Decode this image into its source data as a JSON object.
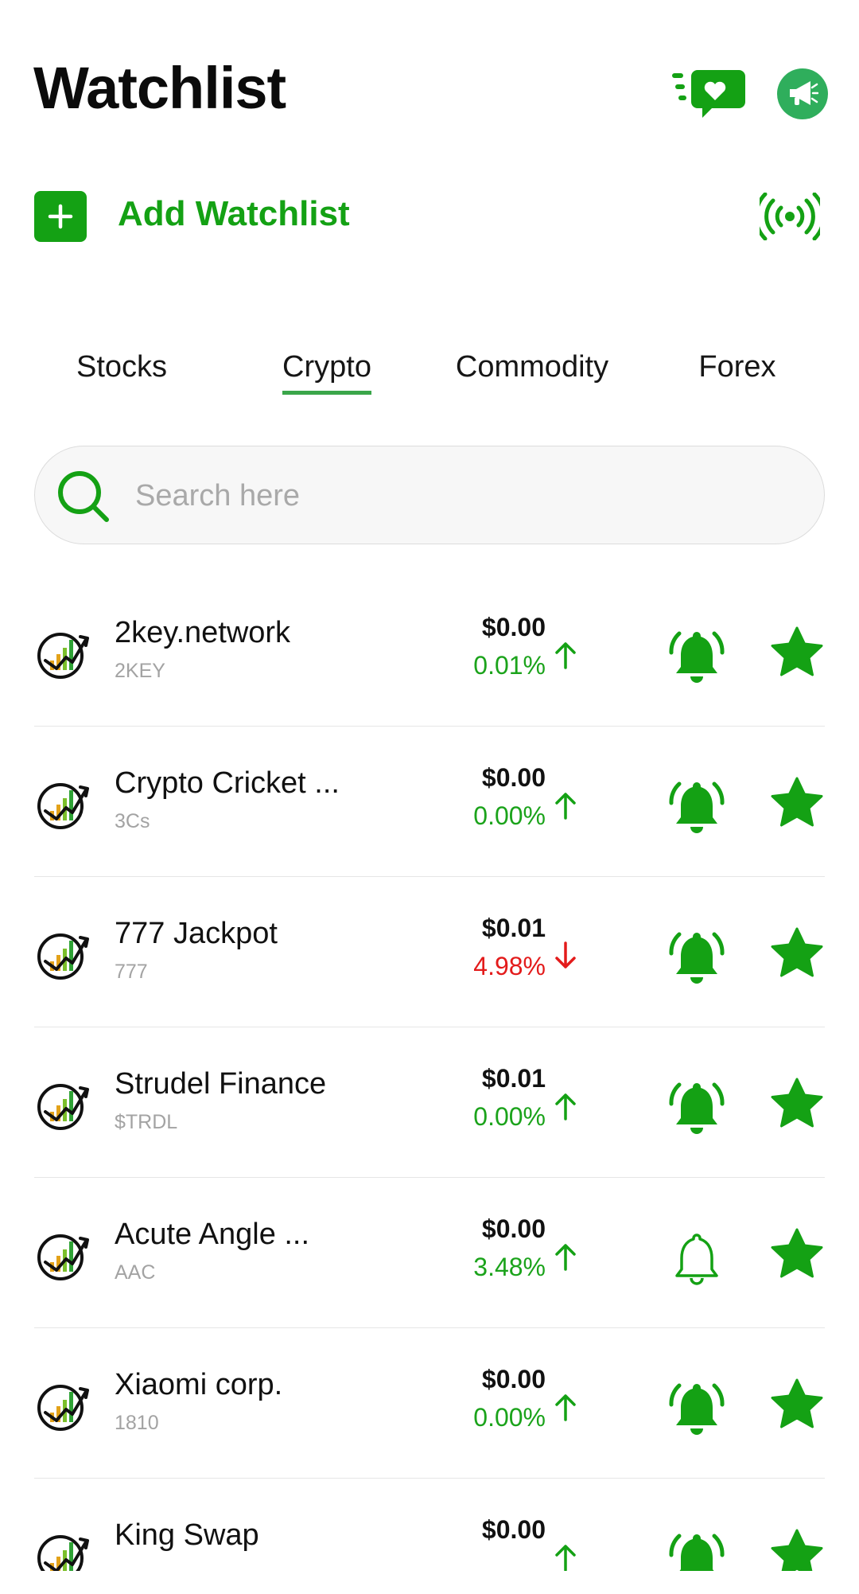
{
  "header": {
    "title": "Watchlist",
    "feed_icon": "feed-heart-icon",
    "profile_icon": "megaphone-icon"
  },
  "add_watchlist": {
    "label": "Add Watchlist",
    "icon": "plus-icon",
    "live_icon": "broadcast-signal-icon"
  },
  "tabs": [
    {
      "label": "Stocks",
      "active": false
    },
    {
      "label": "Crypto",
      "active": true
    },
    {
      "label": "Commodity",
      "active": false
    },
    {
      "label": "Forex",
      "active": false
    }
  ],
  "search": {
    "placeholder": "Search here",
    "value": ""
  },
  "items": [
    {
      "name": "2key.network",
      "symbol": "2KEY",
      "price": "$0.00",
      "change": "0.01%",
      "direction": "up",
      "alert": "on",
      "favorite": true
    },
    {
      "name": "Crypto Cricket ...",
      "symbol": "3Cs",
      "price": "$0.00",
      "change": "0.00%",
      "direction": "up",
      "alert": "on",
      "favorite": true
    },
    {
      "name": "777 Jackpot",
      "symbol": "777",
      "price": "$0.01",
      "change": "4.98%",
      "direction": "down",
      "alert": "on",
      "favorite": true
    },
    {
      "name": "Strudel Finance",
      "symbol": "$TRDL",
      "price": "$0.01",
      "change": "0.00%",
      "direction": "up",
      "alert": "on",
      "favorite": true
    },
    {
      "name": "Acute Angle ...",
      "symbol": "AAC",
      "price": "$0.00",
      "change": "3.48%",
      "direction": "up",
      "alert": "off",
      "favorite": true
    },
    {
      "name": "Xiaomi corp.",
      "symbol": "1810",
      "price": "$0.00",
      "change": "0.00%",
      "direction": "up",
      "alert": "on",
      "favorite": true
    },
    {
      "name": "King Swap",
      "symbol": "",
      "price": "$0.00",
      "change": "",
      "direction": "up",
      "alert": "on",
      "favorite": true
    }
  ],
  "colors": {
    "accent": "#14a114",
    "down": "#e31b1b",
    "muted": "#a3a3a3"
  }
}
